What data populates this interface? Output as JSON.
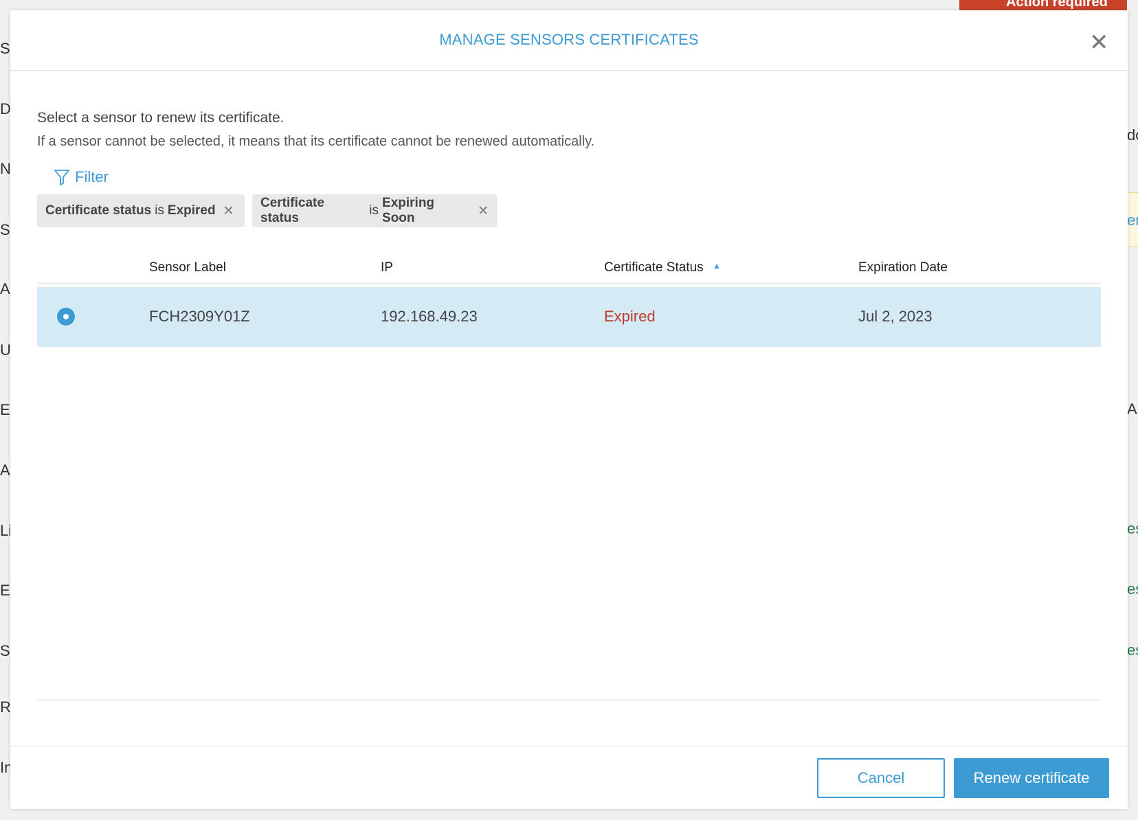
{
  "background": {
    "left_fragments": [
      "Sy",
      "D",
      "N",
      "Se",
      "A",
      "U",
      "Ev",
      "A",
      "Li",
      "Ex",
      "Sn",
      "Ri",
      "In"
    ],
    "right_fragments": [
      "do",
      "er",
      "A",
      "es",
      "es",
      "es"
    ],
    "action_badge": "Action required"
  },
  "modal": {
    "title": "MANAGE SENSORS CERTIFICATES",
    "instruction": "Select a sensor to renew its certificate.",
    "note": "If a sensor cannot be selected, it means that its certificate cannot be renewed automatically.",
    "filter_label": "Filter",
    "chips": [
      {
        "field": "Certificate status",
        "op": "is",
        "value": "Expired"
      },
      {
        "field": "Certificate status",
        "op": "is",
        "value": "Expiring Soon"
      }
    ],
    "table": {
      "columns": [
        "Sensor Label",
        "IP",
        "Certificate Status",
        "Expiration Date"
      ],
      "sort": {
        "column": "Certificate Status",
        "direction": "ascending"
      },
      "rows": [
        {
          "label": "FCH2309Y01Z",
          "ip": "192.168.49.23",
          "status": "Expired",
          "expiration": "Jul 2, 2023",
          "selected": true
        }
      ]
    },
    "cancel_label": "Cancel",
    "renew_label": "Renew certificate"
  },
  "colors": {
    "accent": "#3d9bd4",
    "expired": "#c0392b",
    "selected_row": "#d4eaf5",
    "badge": "#c8432a"
  }
}
